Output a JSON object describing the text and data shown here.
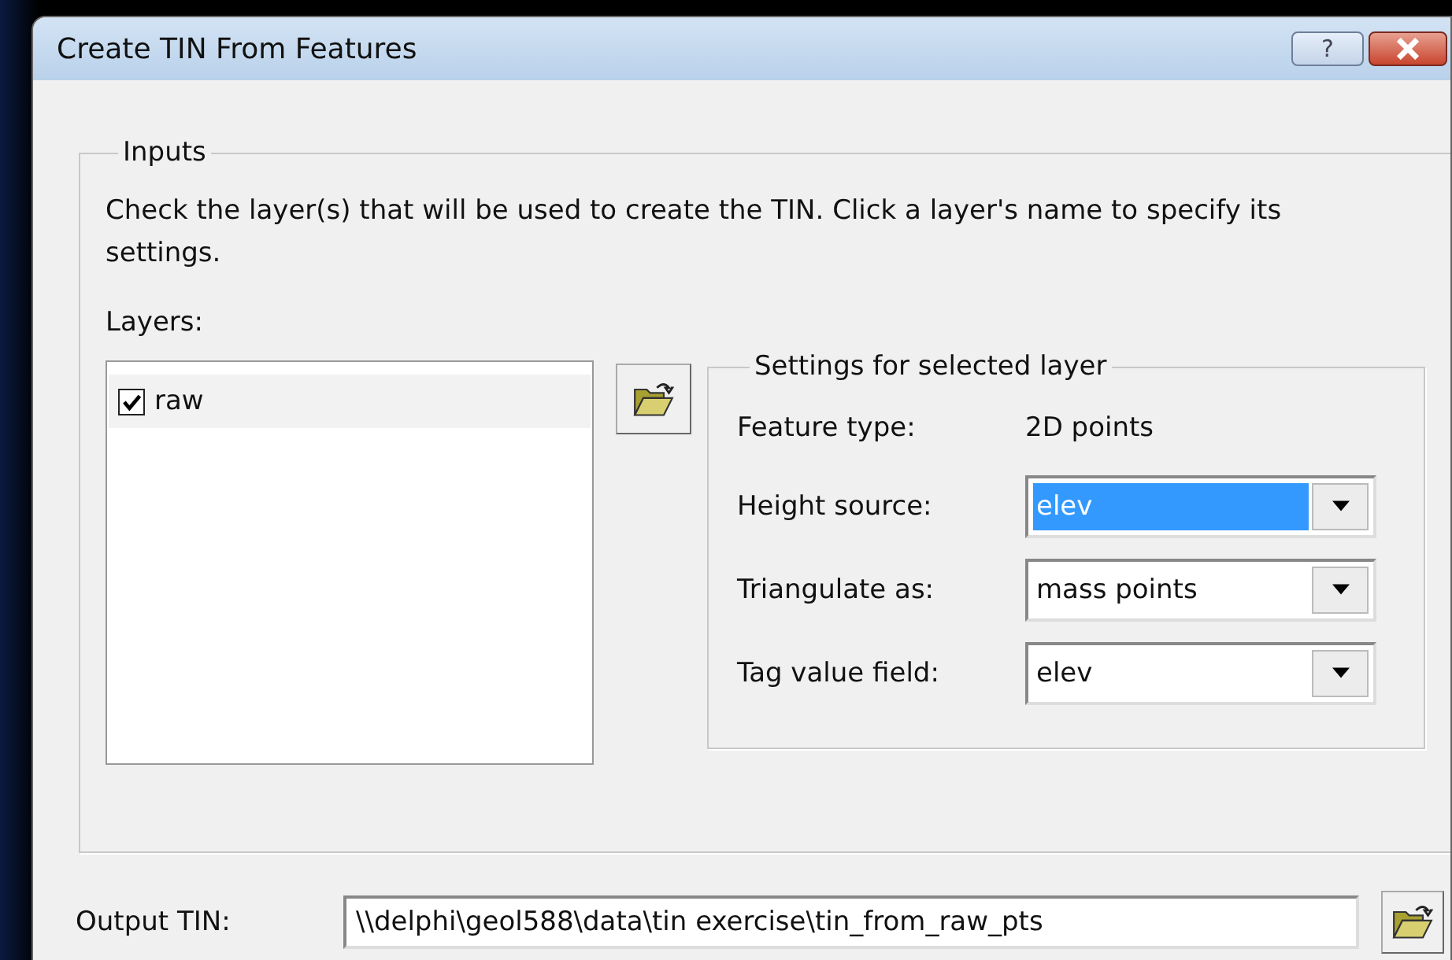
{
  "window": {
    "title": "Create TIN From Features",
    "help_button": "?"
  },
  "inputs": {
    "legend": "Inputs",
    "instructions": "Check the layer(s) that will be used to create the TIN.  Click a layer's name to specify its settings.",
    "layers_label": "Layers:",
    "layers": [
      {
        "name": "raw",
        "checked": true,
        "selected": true
      }
    ],
    "settings": {
      "legend": "Settings for selected layer",
      "rows": [
        {
          "kind": "static",
          "label": "Feature type:",
          "value": "2D points"
        },
        {
          "kind": "combo",
          "label": "Height source:",
          "value": "elev",
          "text_selected": true
        },
        {
          "kind": "combo",
          "label": "Triangulate as:",
          "value": "mass points",
          "text_selected": false
        },
        {
          "kind": "combo",
          "label": "Tag value field:",
          "value": "elev",
          "text_selected": false
        }
      ]
    }
  },
  "output": {
    "label": "Output TIN:",
    "value": "\\\\delphi\\geol588\\data\\tin exercise\\tin_from_raw_pts"
  }
}
